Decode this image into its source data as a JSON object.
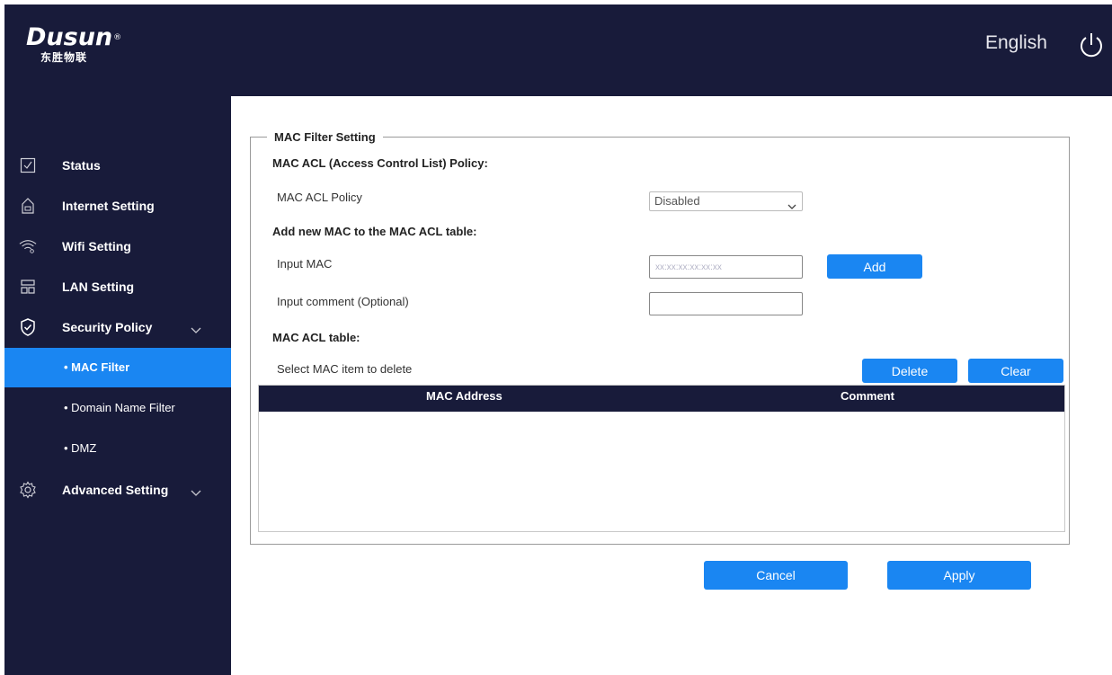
{
  "header": {
    "logo_text": "Dusun",
    "logo_registered": "®",
    "logo_sub": "东胜物联",
    "language": "English",
    "power_icon": "power-icon"
  },
  "sidebar": {
    "items": [
      {
        "label": "Status",
        "icon": "status-icon"
      },
      {
        "label": "Internet Setting",
        "icon": "router-icon"
      },
      {
        "label": "Wifi Setting",
        "icon": "wifi-icon"
      },
      {
        "label": "LAN Setting",
        "icon": "lan-icon"
      },
      {
        "label": "Security Policy",
        "icon": "shield-icon"
      },
      {
        "label": "Advanced Setting",
        "icon": "gear-icon"
      }
    ],
    "sub_items": [
      {
        "label": "• MAC Filter",
        "active": true
      },
      {
        "label": "• Domain Name Filter",
        "active": false
      },
      {
        "label": "• DMZ",
        "active": false
      }
    ]
  },
  "main": {
    "legend": "MAC Filter Setting",
    "policy_section": "MAC ACL (Access Control List) Policy:",
    "policy_label": "MAC ACL Policy",
    "policy_value": "Disabled",
    "add_section": "Add new MAC to the MAC ACL table:",
    "input_mac_label": "Input MAC",
    "input_mac_placeholder": "xx:xx:xx:xx:xx:xx",
    "input_mac_value": "",
    "input_comment_label": "Input comment (Optional)",
    "input_comment_value": "",
    "add_button": "Add",
    "table_section": "MAC ACL table:",
    "select_delete_label": "Select MAC item to delete",
    "delete_button": "Delete",
    "clear_button": "Clear",
    "columns": [
      "MAC Address",
      "Comment"
    ],
    "rows": []
  },
  "footer": {
    "cancel_button": "Cancel",
    "apply_button": "Apply"
  },
  "colors": {
    "nav_bg": "#181b3a",
    "accent": "#1a86f2"
  }
}
